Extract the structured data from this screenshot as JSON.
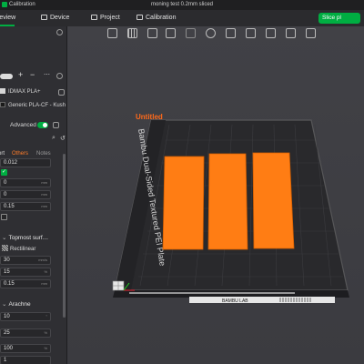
{
  "titlebar": {
    "app_name": "Calibration",
    "project_name": "moning test 0.2mm sliced"
  },
  "tabs": {
    "preview": "review",
    "device": "Device",
    "project": "Project",
    "calibration": "Calibration",
    "slice_button": "Slice pl"
  },
  "left_panel": {
    "filaments": [
      {
        "name": "IDMAX PLA+",
        "color": "#d6d6d6"
      },
      {
        "name": "Generic PLA-CF - Kush",
        "color": "#1a1a1a"
      }
    ],
    "advanced_label": "Advanced",
    "subtabs": {
      "left": "ort",
      "others": "Others",
      "notes": "Notes"
    },
    "fields_top": [
      {
        "value": "0.012",
        "unit": ""
      },
      {
        "value": "0",
        "unit": "mm"
      },
      {
        "value": "0",
        "unit": "mm"
      },
      {
        "value": "0.15",
        "unit": "mm"
      }
    ],
    "topmost_surface": {
      "title": "Topmost surf…",
      "pattern": "Rectilinear",
      "fields": [
        {
          "value": "30",
          "unit": "mm/s"
        },
        {
          "value": "15",
          "unit": "%"
        },
        {
          "value": "0.15",
          "unit": "mm"
        }
      ]
    },
    "arachne": {
      "title": "Arachne",
      "fields": [
        {
          "value": "10",
          "unit": "°"
        },
        {
          "value": "25",
          "unit": "%"
        },
        {
          "value": "100",
          "unit": "%"
        },
        {
          "value": "1",
          "unit": ""
        }
      ]
    }
  },
  "plate": {
    "name": "Untitled",
    "type_label": "Bambu Dual-Sided Textured PEI Plate",
    "brand_label": "BAMBU LAB"
  },
  "colors": {
    "accent": "#00ae42",
    "object_orange": "#ff7d14",
    "plate_name": "#ff6a1a"
  }
}
